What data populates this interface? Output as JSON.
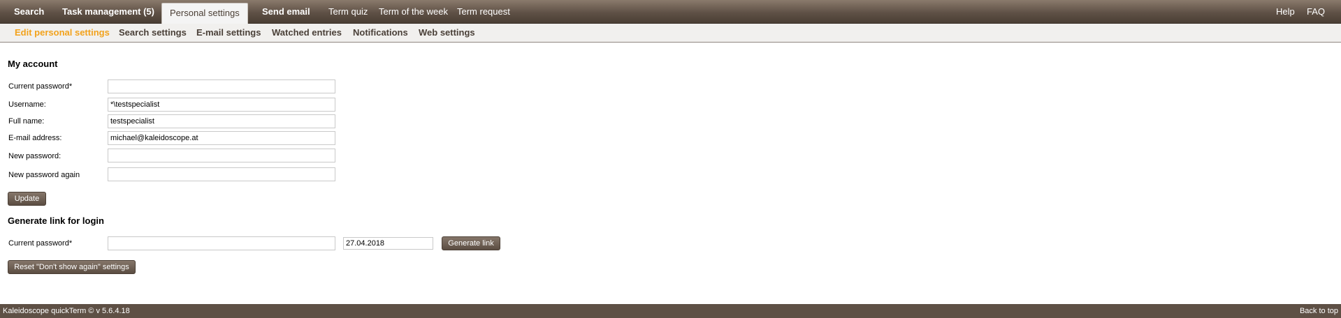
{
  "topnav": {
    "search": "Search",
    "task_management": "Task management (5)",
    "personal_settings": "Personal settings",
    "send_email": "Send email",
    "term_quiz": "Term quiz",
    "term_of_the_week": "Term of the week",
    "term_request": "Term request",
    "help": "Help",
    "faq": "FAQ"
  },
  "subnav": {
    "edit_personal_settings": "Edit personal settings",
    "search_settings": "Search settings",
    "email_settings": "E-mail settings",
    "watched_entries": "Watched entries",
    "notifications": "Notifications",
    "web_settings": "Web settings"
  },
  "account": {
    "title": "My account",
    "current_password_label": "Current password*",
    "current_password_value": "",
    "username_label": "Username:",
    "username_value": "*\\testspecialist",
    "fullname_label": "Full name:",
    "fullname_value": "testspecialist",
    "email_label": "E-mail address:",
    "email_value": "michael@kaleidoscope.at",
    "new_password_label": "New password:",
    "new_password_value": "",
    "new_password_again_label": "New password again",
    "new_password_again_value": "",
    "update_button": "Update"
  },
  "login_link": {
    "title": "Generate link for login",
    "current_password_label": "Current password*",
    "current_password_value": "",
    "date_value": "27.04.2018",
    "generate_button": "Generate link"
  },
  "reset_button": "Reset \"Don't show again\" settings",
  "footer": {
    "version": "Kaleidoscope quickTerm © v 5.6.4.18",
    "back_to_top": "Back to top"
  },
  "colors": {
    "nav_brown": "#5f5146",
    "active_subnav": "#f2a21b",
    "footer_brown": "#5e5045"
  }
}
